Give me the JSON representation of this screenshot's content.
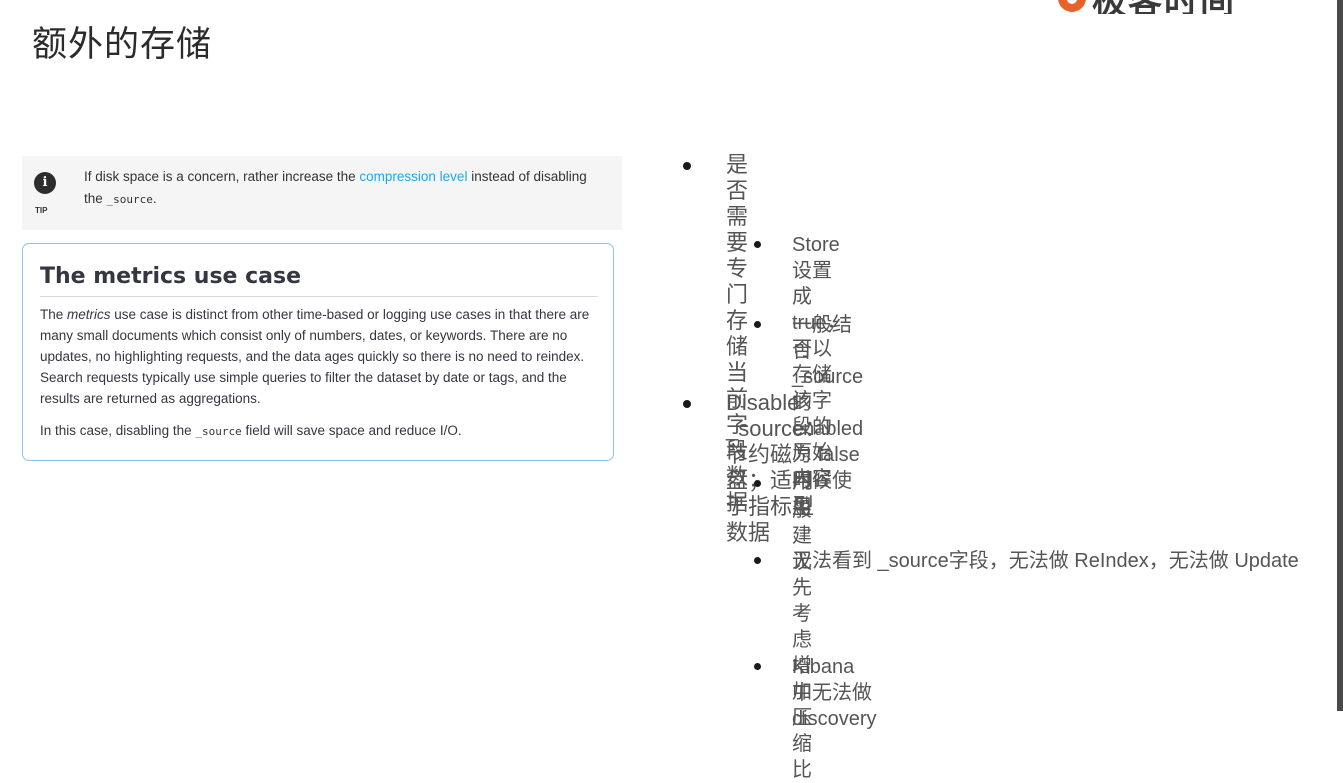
{
  "slide": {
    "title": "额外的存储",
    "logo_text": "极客时间"
  },
  "tip": {
    "label": "TIP",
    "icon": "info-icon",
    "text_before": "If disk space is a concern, rather increase the ",
    "link": "compression level",
    "text_mid": " instead of disabling the ",
    "code": "_source",
    "text_after": "."
  },
  "metrics": {
    "title": "The metrics use case",
    "p1_pre": "The ",
    "p1_em": "metrics",
    "p1_post": " use case is distinct from other time-based or logging use cases in that there are many small documents which consist only of numbers, dates, or keywords. There are no updates, no highlighting requests, and the data ages quickly so there is no need to reindex. Search requests typically use simple queries to filter the dataset by date or tags, and the results are returned as aggregations.",
    "p2_pre": "In this case, disabling the ",
    "p2_code": "_source",
    "p2_post": " field will save space and reduce I/O."
  },
  "bullets": [
    {
      "text": "是否需要专门存储当前字段数据",
      "level": 1
    },
    {
      "text": "Store 设置成 true，可以存储该字段的原始内容",
      "level": 2
    },
    {
      "text": "一般结合 _source 的 enabled 为 false 时候使用",
      "level": 2
    },
    {
      "text": "Disable _source：节约磁盘；适用于指标型数据",
      "level": 1
    },
    {
      "text": "一般建议先考虑增加压缩比",
      "level": 2
    },
    {
      "text": "无法看到 _source字段，无法做 ReIndex，无法做 Update",
      "level": 2
    },
    {
      "text": "Kibana 中无法做 discovery",
      "level": 2
    }
  ]
}
